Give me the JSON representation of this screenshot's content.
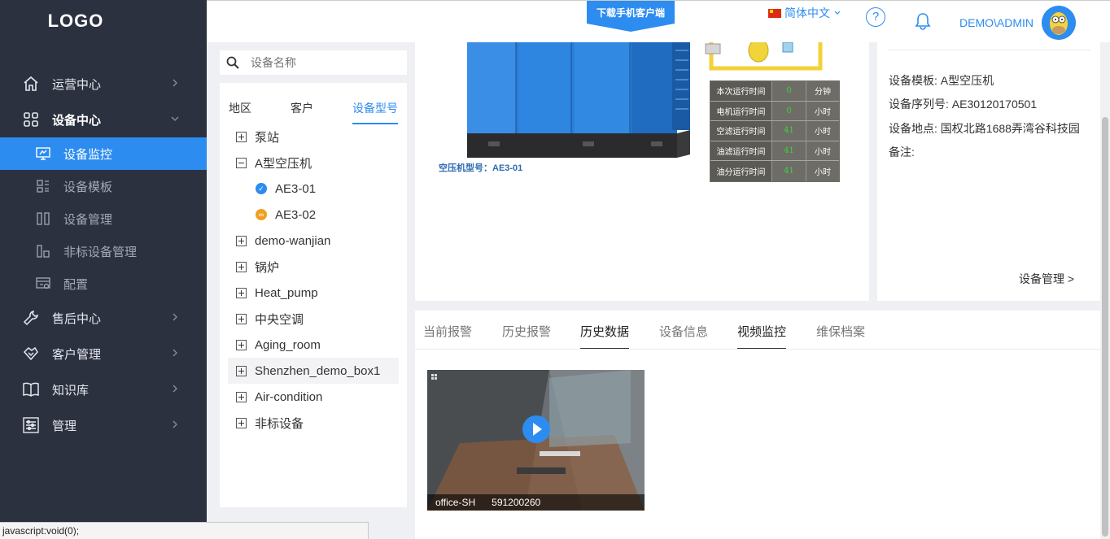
{
  "app": {
    "logo": "LOGO"
  },
  "sidebar": {
    "items": [
      {
        "label": "运营中心",
        "icon": "home-icon"
      },
      {
        "label": "设备中心",
        "icon": "grid-icon"
      },
      {
        "label": "售后中心",
        "icon": "wrench-icon"
      },
      {
        "label": "客户管理",
        "icon": "handshake-icon"
      },
      {
        "label": "知识库",
        "icon": "book-icon"
      },
      {
        "label": "管理",
        "icon": "settings-panel-icon"
      }
    ],
    "subitems": [
      {
        "label": "设备监控",
        "icon": "monitor-icon",
        "active": true
      },
      {
        "label": "设备模板",
        "icon": "template-icon"
      },
      {
        "label": "设备管理",
        "icon": "columns-icon"
      },
      {
        "label": "非标设备管理",
        "icon": "nonstandard-icon"
      },
      {
        "label": "配置",
        "icon": "config-icon"
      }
    ]
  },
  "topbar": {
    "download_label": "下载手机客户端",
    "language": "简体中文",
    "help": "?",
    "user": "DEMO\\ADMIN",
    "accent": "#2d8cf0"
  },
  "tree": {
    "search_placeholder": "设备名称",
    "tabs": [
      "地区",
      "客户",
      "设备型号"
    ],
    "nodes": [
      {
        "label": "泵站",
        "toggle": "+"
      },
      {
        "label": "A型空压机",
        "toggle": "-"
      },
      {
        "label": "AE3-01",
        "status": "online"
      },
      {
        "label": "AE3-02",
        "status": "offline"
      },
      {
        "label": "demo-wanjian",
        "toggle": "+"
      },
      {
        "label": "锅炉",
        "toggle": "+"
      },
      {
        "label": "Heat_pump",
        "toggle": "+"
      },
      {
        "label": "中央空调",
        "toggle": "+"
      },
      {
        "label": "Aging_room",
        "toggle": "+"
      },
      {
        "label": "Shenzhen_demo_box1",
        "toggle": "+"
      },
      {
        "label": "Air-condition",
        "toggle": "+"
      },
      {
        "label": "非标设备",
        "toggle": "+"
      }
    ]
  },
  "diagram": {
    "model_caption": "空压机型号：AE3-01",
    "stats": [
      {
        "name": "本次运行时间",
        "value": "0",
        "unit": "分钟"
      },
      {
        "name": "电机运行时间",
        "value": "0",
        "unit": "小时"
      },
      {
        "name": "空滤运行时间",
        "value": "41",
        "unit": "小时"
      },
      {
        "name": "油滤运行时间",
        "value": "41",
        "unit": "小时"
      },
      {
        "name": "油分运行时间",
        "value": "41",
        "unit": "小时"
      }
    ]
  },
  "info": {
    "template": "设备模板: A型空压机",
    "serial": "设备序列号: AE30120170501",
    "location": "设备地点: 国权北路1688弄湾谷科技园",
    "remark": "备注:",
    "manage_link": "设备管理 >"
  },
  "detail_tabs": {
    "tabs": [
      "当前报警",
      "历史报警",
      "历史数据",
      "设备信息",
      "视频监控",
      "维保档案"
    ],
    "video": {
      "name": "office-SH",
      "id": "591200260"
    }
  },
  "statusbar": {
    "text": "javascript:void(0);"
  }
}
